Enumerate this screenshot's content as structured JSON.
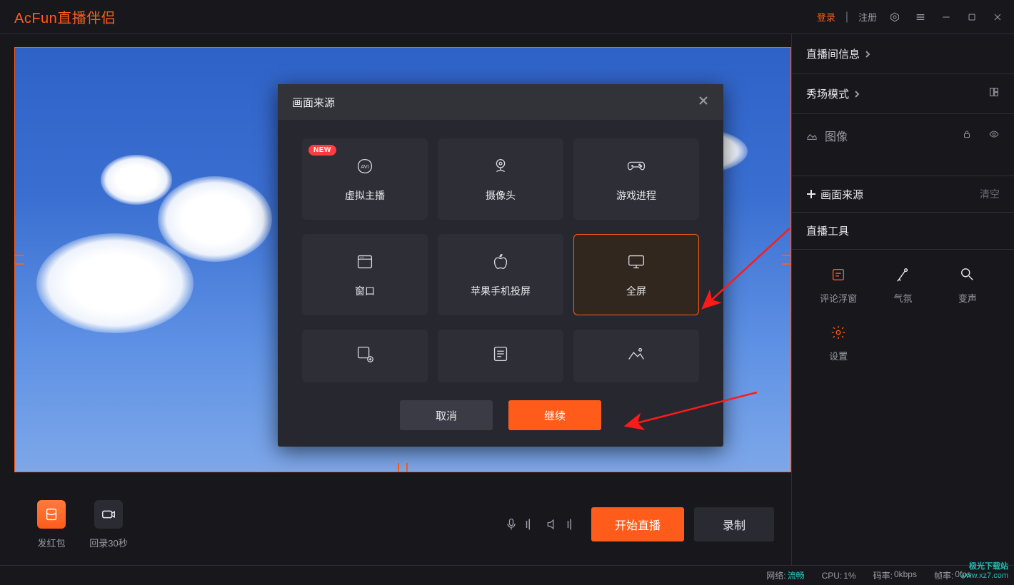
{
  "title_bar": {
    "brand": "AcFun直播伴侣",
    "login": "登录",
    "register": "注册"
  },
  "bottom_strip": {
    "red_packet": "发红包",
    "replay": "回录30秒",
    "start_live": "开始直播",
    "record": "录制"
  },
  "right_panel": {
    "room_info": "直播间信息",
    "show_mode": "秀场模式",
    "src_image": "图像",
    "add_source": "画面来源",
    "clear": "清空",
    "tools_title": "直播工具",
    "tools": {
      "danmaku": "评论浮窗",
      "atmosphere": "气氛",
      "voice": "变声",
      "settings": "设置"
    }
  },
  "modal": {
    "title": "画面来源",
    "badge_new": "NEW",
    "options": {
      "vtuber": "虚拟主播",
      "camera": "摄像头",
      "game": "游戏进程",
      "window": "窗口",
      "iphone": "苹果手机投屏",
      "fullscreen": "全屏",
      "capture": "截屏",
      "text": "文字",
      "image": "图片"
    },
    "cancel": "取消",
    "continue": "继续"
  },
  "status": {
    "net_label": "网络:",
    "net_value": "流畅",
    "cpu_label": "CPU:",
    "cpu_value": "1%",
    "bitrate_label": "码率:",
    "bitrate_value": "0kbps",
    "fps_label": "帧率:",
    "fps_value": "0fps"
  },
  "watermark": {
    "line1": "极光下载站",
    "line2": "www.xz7.com"
  }
}
